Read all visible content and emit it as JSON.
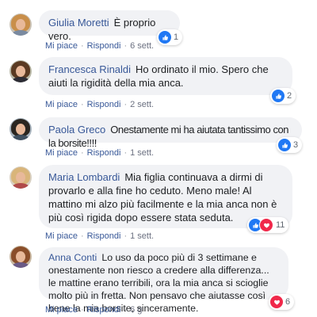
{
  "colors": {
    "name": "#385898",
    "bubble": "#f1f2f5",
    "like": "#2078f4",
    "love": "#f0284a"
  },
  "actions": {
    "like": "Mi piace",
    "reply": "Rispondi",
    "dot": "·"
  },
  "comments": [
    {
      "author": "Giulia Moretti",
      "text": "È proprio vero.",
      "time": "6 sett.",
      "reactions": [
        "like-icon"
      ],
      "count": "1"
    },
    {
      "author": "Francesca Rinaldi",
      "text": "Ho ordinato il mio. Spero che aiuti la rigidità della mia anca.",
      "time": "2 sett.",
      "reactions": [
        "like-icon"
      ],
      "count": "2"
    },
    {
      "author": "Paola Greco",
      "text": "Onestamente mi ha aiutata tantissimo con la borsite!!!!",
      "time": "1 sett.",
      "reactions": [
        "like-icon"
      ],
      "count": "3"
    },
    {
      "author": "Maria Lombardi",
      "text": "Mia figlia continuava a dirmi di provarlo e alla fine ho ceduto. Meno male! Al mattino mi alzo più facilmente e la mia anca non è più così rigida dopo essere stata seduta.",
      "time": "1 sett.",
      "reactions": [
        "like-icon",
        "heart-icon"
      ],
      "count": "11"
    },
    {
      "author": "Anna Conti",
      "text": "Lo uso da poco più di 3 settimane e onestamente non riesco a credere alla differenza... le mattine erano terribili, ora la mia anca si scioglie molto più in fretta. Non pensavo che aiutasse così bene la mia borsite, sinceramente.",
      "time": "6 g",
      "reactions": [
        "heart-icon"
      ],
      "count": "6"
    }
  ]
}
